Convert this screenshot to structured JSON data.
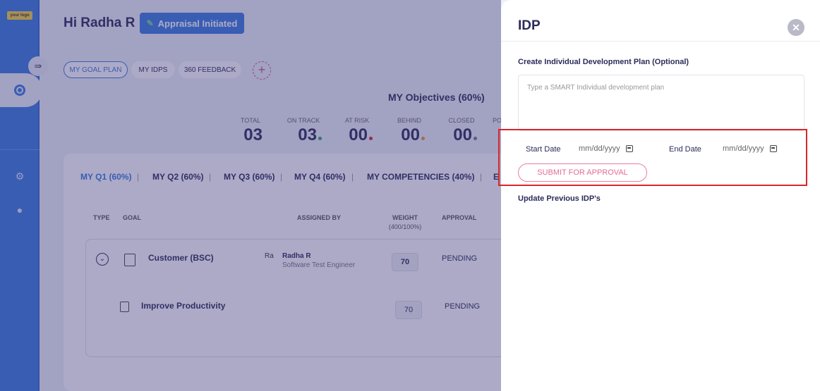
{
  "brand": {
    "logo_text": "your logo"
  },
  "header": {
    "greeting": "Hi Radha R",
    "appraisal_button": "Appraisal Initiated"
  },
  "pills": [
    "MY GOAL PLAN",
    "MY IDPS",
    "360 FEEDBACK"
  ],
  "objectives": {
    "title": "MY Objectives (60%)",
    "stats": [
      {
        "label": "TOTAL",
        "value": "03",
        "dot": ""
      },
      {
        "label": "ON TRACK",
        "value": "03",
        "dot": "#2fa36b"
      },
      {
        "label": "AT RISK",
        "value": "00",
        "dot": "#d8262a"
      },
      {
        "label": "BEHIND",
        "value": "00",
        "dot": "#e8962a"
      },
      {
        "label": "CLOSED",
        "value": "00",
        "dot": "#777777"
      }
    ],
    "stat_truncated": "PO"
  },
  "quarter_tabs": [
    "MY Q1 (60%)",
    "MY Q2 (60%)",
    "MY Q3 (60%)",
    "MY Q4 (60%)",
    "MY COMPETENCIES (40%)",
    "E"
  ],
  "table": {
    "headers": {
      "type": "TYPE",
      "goal": "GOAL",
      "assigned_by": "ASSIGNED BY",
      "weight": "WEIGHT",
      "weight_sub": "(400/100%)",
      "approval": "APPROVAL"
    },
    "rows": [
      {
        "goal": "Customer (BSC)",
        "assigned_name": "Radha R",
        "assigned_role": "Software Test Engineer",
        "avatar_text": "Ra",
        "weight": "70",
        "approval": "PENDING"
      },
      {
        "goal": "Improve Productivity",
        "weight": "70",
        "approval": "PENDING"
      }
    ]
  },
  "idp_panel": {
    "title": "IDP",
    "create_label": "Create Individual Development Plan (Optional)",
    "textarea_placeholder": "Type a SMART Individual development plan",
    "start_date_label": "Start Date",
    "start_date_placeholder": "mm/dd/yyyy",
    "end_date_label": "End Date",
    "end_date_placeholder": "mm/dd/yyyy",
    "submit_label": "SUBMIT FOR APPROVAL",
    "update_label": "Update Previous IDP's"
  }
}
